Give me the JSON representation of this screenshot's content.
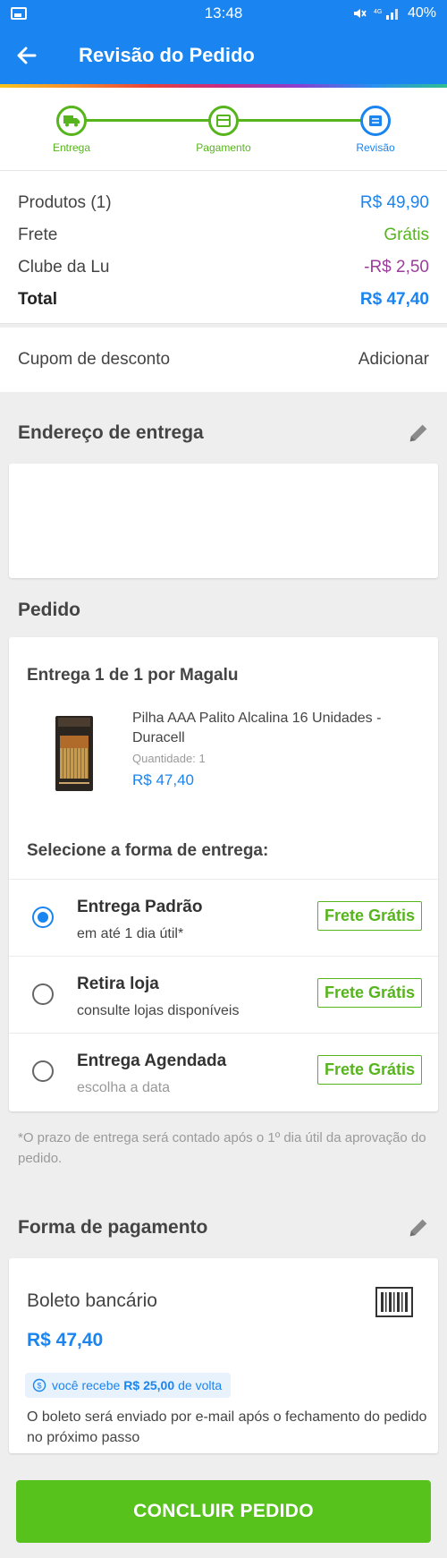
{
  "status_bar": {
    "time": "13:48",
    "battery": "40%",
    "signal_icon": "signal-icon",
    "mute_icon": "mute-icon"
  },
  "header": {
    "title": "Revisão do Pedido",
    "back_icon": "arrow-left-icon"
  },
  "steps": [
    {
      "label": "Entrega",
      "icon": "truck-icon",
      "state": "done"
    },
    {
      "label": "Pagamento",
      "icon": "card-icon",
      "state": "done"
    },
    {
      "label": "Revisão",
      "icon": "list-icon",
      "state": "current"
    }
  ],
  "summary": {
    "produtos_label": "Produtos (1)",
    "produtos_value": "R$ 49,90",
    "frete_label": "Frete",
    "frete_value": "Grátis",
    "clube_label": "Clube da Lu",
    "clube_value": "-R$ 2,50",
    "total_label": "Total",
    "total_value": "R$ 47,40"
  },
  "coupon": {
    "label": "Cupom de desconto",
    "action": "Adicionar"
  },
  "address": {
    "title": "Endereço de entrega"
  },
  "order": {
    "title": "Pedido",
    "shipment_title": "Entrega 1 de 1 por Magalu",
    "product": {
      "name": "Pilha AAA Palito Alcalina 16 Unidades - Duracell",
      "quantity": "Quantidade:  1",
      "price": "R$ 47,40"
    },
    "select_title": "Selecione a forma de entrega:",
    "options": [
      {
        "name": "Entrega Padrão",
        "sub": "em até 1 dia útil*",
        "badge": "Frete Grátis",
        "selected": true
      },
      {
        "name": "Retira loja",
        "sub": "consulte lojas disponíveis",
        "badge": "Frete Grátis",
        "selected": false
      },
      {
        "name": "Entrega Agendada",
        "sub": "escolha a data",
        "badge": "Frete Grátis",
        "selected": false
      }
    ]
  },
  "note": "*O prazo de entrega será contado após o 1º dia útil da aprovação do pedido.",
  "payment": {
    "title": "Forma de pagamento",
    "method": "Boleto bancário",
    "amount": "R$ 47,40",
    "cashback_prefix": "você recebe",
    "cashback_value": "R$ 25,00",
    "cashback_suffix": "de volta",
    "description": "O boleto será enviado por e-mail após o fechamento do pedido no próximo passo"
  },
  "cta": {
    "label": "CONCLUIR PEDIDO"
  },
  "colors": {
    "primary": "#1a84f0",
    "green": "#56b51d",
    "cta_green": "#56c21b",
    "purple": "#9b3d9b"
  }
}
